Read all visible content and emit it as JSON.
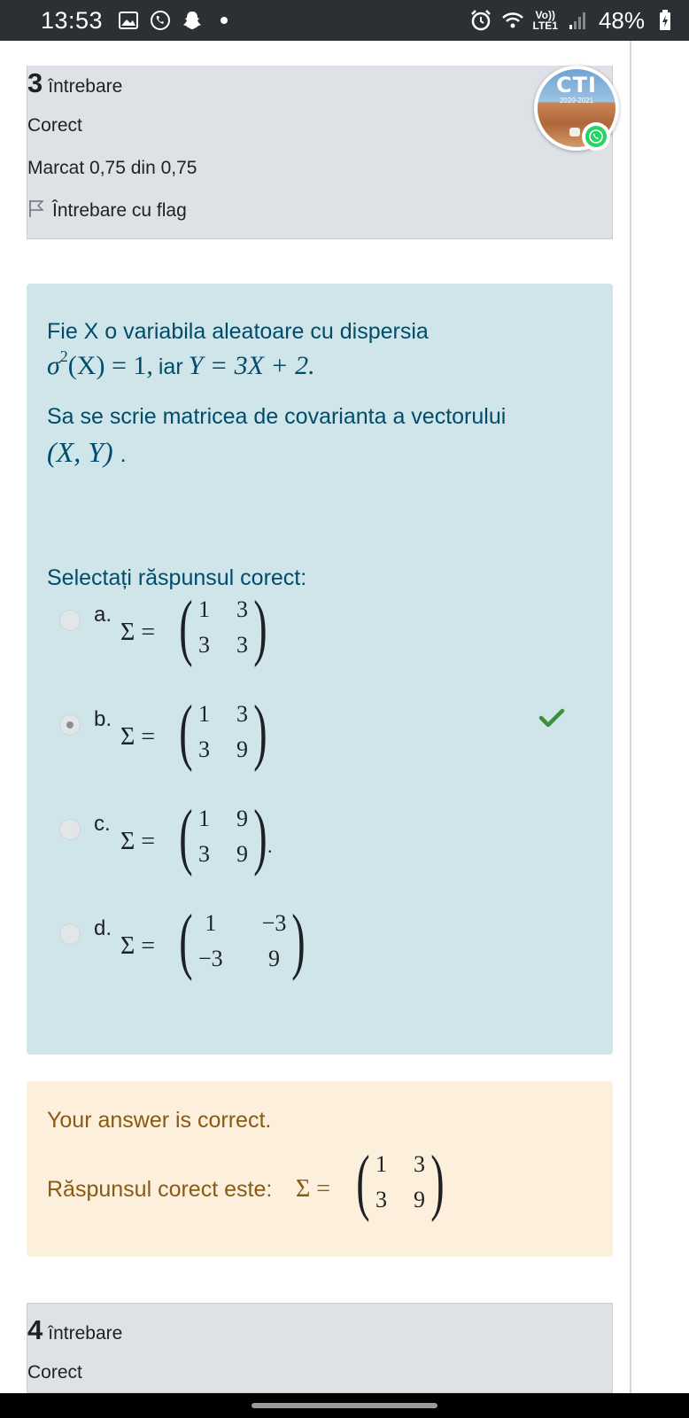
{
  "status_bar": {
    "time": "13:53",
    "network_top": "Vo))",
    "network_bottom": "LTE1",
    "battery": "48%"
  },
  "question3": {
    "number": "3",
    "word": "întrebare",
    "status": "Corect",
    "mark": "Marcat 0,75 din 0,75",
    "flag_label": "Întrebare cu flag",
    "avatar_text": "CTI",
    "avatar_sub": "2020-2021",
    "text_line1": "Fie X o variabila aleatoare cu dispersia",
    "formula_sigma": "σ",
    "formula_eq1": "(X) = 1,",
    "formula_iar": "iar",
    "formula_eq2": "Y = 3X + 2.",
    "text_line2": "Sa se scrie matricea de covarianta a vectorului",
    "vector": "(X, Y)",
    "vector_dot": ".",
    "prompt": "Selectați răspunsul corect:",
    "sigma_eq": "Σ =",
    "options": [
      {
        "letter": "a.",
        "m": [
          "1",
          "3",
          "3",
          "3"
        ],
        "suffix": ""
      },
      {
        "letter": "b.",
        "m": [
          "1",
          "3",
          "3",
          "9"
        ],
        "suffix": ""
      },
      {
        "letter": "c.",
        "m": [
          "1",
          "9",
          "3",
          "9"
        ],
        "suffix": "."
      },
      {
        "letter": "d.",
        "m": [
          "1",
          "−3",
          "−3",
          "9"
        ],
        "suffix": ""
      }
    ],
    "selected_option": "b",
    "feedback_correct": "Your answer is correct.",
    "feedback_answer_label": "Răspunsul corect este:",
    "feedback_matrix": [
      "1",
      "3",
      "3",
      "9"
    ]
  },
  "question4": {
    "number": "4",
    "word": "întrebare",
    "status": "Corect"
  },
  "colors": {
    "formulation_bg": "#cfe5ea",
    "feedback_bg": "#fcefdc",
    "info_bg": "#dee2e6",
    "check_green": "#3d8f3d"
  }
}
